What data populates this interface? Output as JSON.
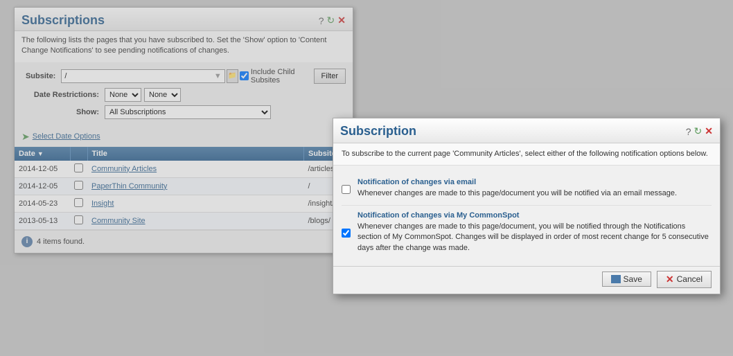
{
  "subscriptions": {
    "title": "Subscriptions",
    "description": "The following lists the pages that you have subscribed to. Set the 'Show' option to 'Content Change Notifications' to see pending notifications of changes.",
    "form": {
      "subsite_label": "Subsite:",
      "subsite_value": "/",
      "date_restrictions_label": "Date Restrictions:",
      "date_restriction_1": "None",
      "date_restriction_2": "None",
      "show_label": "Show:",
      "show_value": "All Subscriptions",
      "include_child_label": "Include Child Subsites",
      "filter_btn": "Filter"
    },
    "select_date_options": "Select Date Options",
    "table": {
      "col_date": "Date",
      "col_title": "Title",
      "col_subsite": "Subsite",
      "rows": [
        {
          "date": "2014-12-05",
          "title": "Community Articles",
          "subsite": "/articles/"
        },
        {
          "date": "2014-12-05",
          "title": "PaperThin Community",
          "subsite": "/"
        },
        {
          "date": "2014-05-23",
          "title": "Insight",
          "subsite": "/insight/"
        },
        {
          "date": "2013-05-13",
          "title": "Community Site",
          "subsite": "/blogs/"
        }
      ]
    },
    "items_found": "4 items found."
  },
  "subscription_dialog": {
    "title": "Subscription",
    "description": "To subscribe to the current page 'Community Articles', select either of the following notification options below.",
    "options": [
      {
        "id": "opt1",
        "checked": false,
        "title": "Notification of changes via email",
        "description": "Whenever changes are made to this page/document you will be notified via an email message."
      },
      {
        "id": "opt2",
        "checked": true,
        "title": "Notification of changes via My CommonSpot",
        "description": "Whenever changes are made to this page/document, you will be notified through the Notifications section of My CommonSpot. Changes will be displayed in order of most recent change for 5 consecutive days after the change was made."
      }
    ],
    "save_btn": "Save",
    "cancel_btn": "Cancel"
  }
}
